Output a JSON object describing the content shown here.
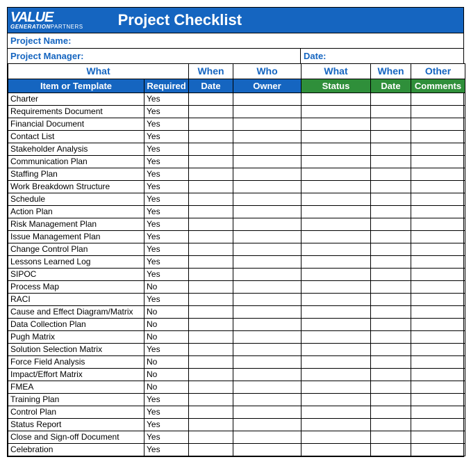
{
  "brand": {
    "logo_top": "VALUE",
    "logo_gen": "GENERATION",
    "logo_part": "PARTNERS"
  },
  "title": "Project Checklist",
  "meta": {
    "project_name_label": "Project Name:",
    "project_manager_label": "Project Manager:",
    "date_label": "Date:"
  },
  "group_headers": {
    "what1": "What",
    "when1": "When",
    "who": "Who",
    "what2": "What",
    "when2": "When",
    "other": "Other"
  },
  "sub_headers": {
    "item": "Item or Template",
    "required": "Required",
    "date1": "Date",
    "owner": "Owner",
    "status": "Status",
    "date2": "Date",
    "comments": "Comments"
  },
  "rows": [
    {
      "item": "Charter",
      "required": "Yes"
    },
    {
      "item": "Requirements Document",
      "required": "Yes"
    },
    {
      "item": "Financial Document",
      "required": "Yes"
    },
    {
      "item": "Contact List",
      "required": "Yes"
    },
    {
      "item": "Stakeholder Analysis",
      "required": "Yes"
    },
    {
      "item": "Communication Plan",
      "required": "Yes"
    },
    {
      "item": "Staffing Plan",
      "required": "Yes"
    },
    {
      "item": "Work Breakdown Structure",
      "required": "Yes"
    },
    {
      "item": "Schedule",
      "required": "Yes"
    },
    {
      "item": "Action Plan",
      "required": "Yes"
    },
    {
      "item": "Risk Management Plan",
      "required": "Yes"
    },
    {
      "item": "Issue Management Plan",
      "required": "Yes"
    },
    {
      "item": "Change Control Plan",
      "required": "Yes"
    },
    {
      "item": "Lessons Learned Log",
      "required": "Yes"
    },
    {
      "item": "SIPOC",
      "required": "Yes"
    },
    {
      "item": "Process Map",
      "required": "No"
    },
    {
      "item": "RACI",
      "required": "Yes"
    },
    {
      "item": "Cause and Effect Diagram/Matrix",
      "required": "No"
    },
    {
      "item": "Data Collection Plan",
      "required": "No"
    },
    {
      "item": "Pugh Matrix",
      "required": "No"
    },
    {
      "item": "Solution Selection Matrix",
      "required": "Yes"
    },
    {
      "item": "Force Field Analysis",
      "required": "No"
    },
    {
      "item": "Impact/Effort Matrix",
      "required": "No"
    },
    {
      "item": "FMEA",
      "required": "No"
    },
    {
      "item": "Training Plan",
      "required": "Yes"
    },
    {
      "item": "Control Plan",
      "required": "Yes"
    },
    {
      "item": "Status Report",
      "required": "Yes"
    },
    {
      "item": "Close and Sign-off Document",
      "required": "Yes"
    },
    {
      "item": "Celebration",
      "required": "Yes"
    }
  ]
}
